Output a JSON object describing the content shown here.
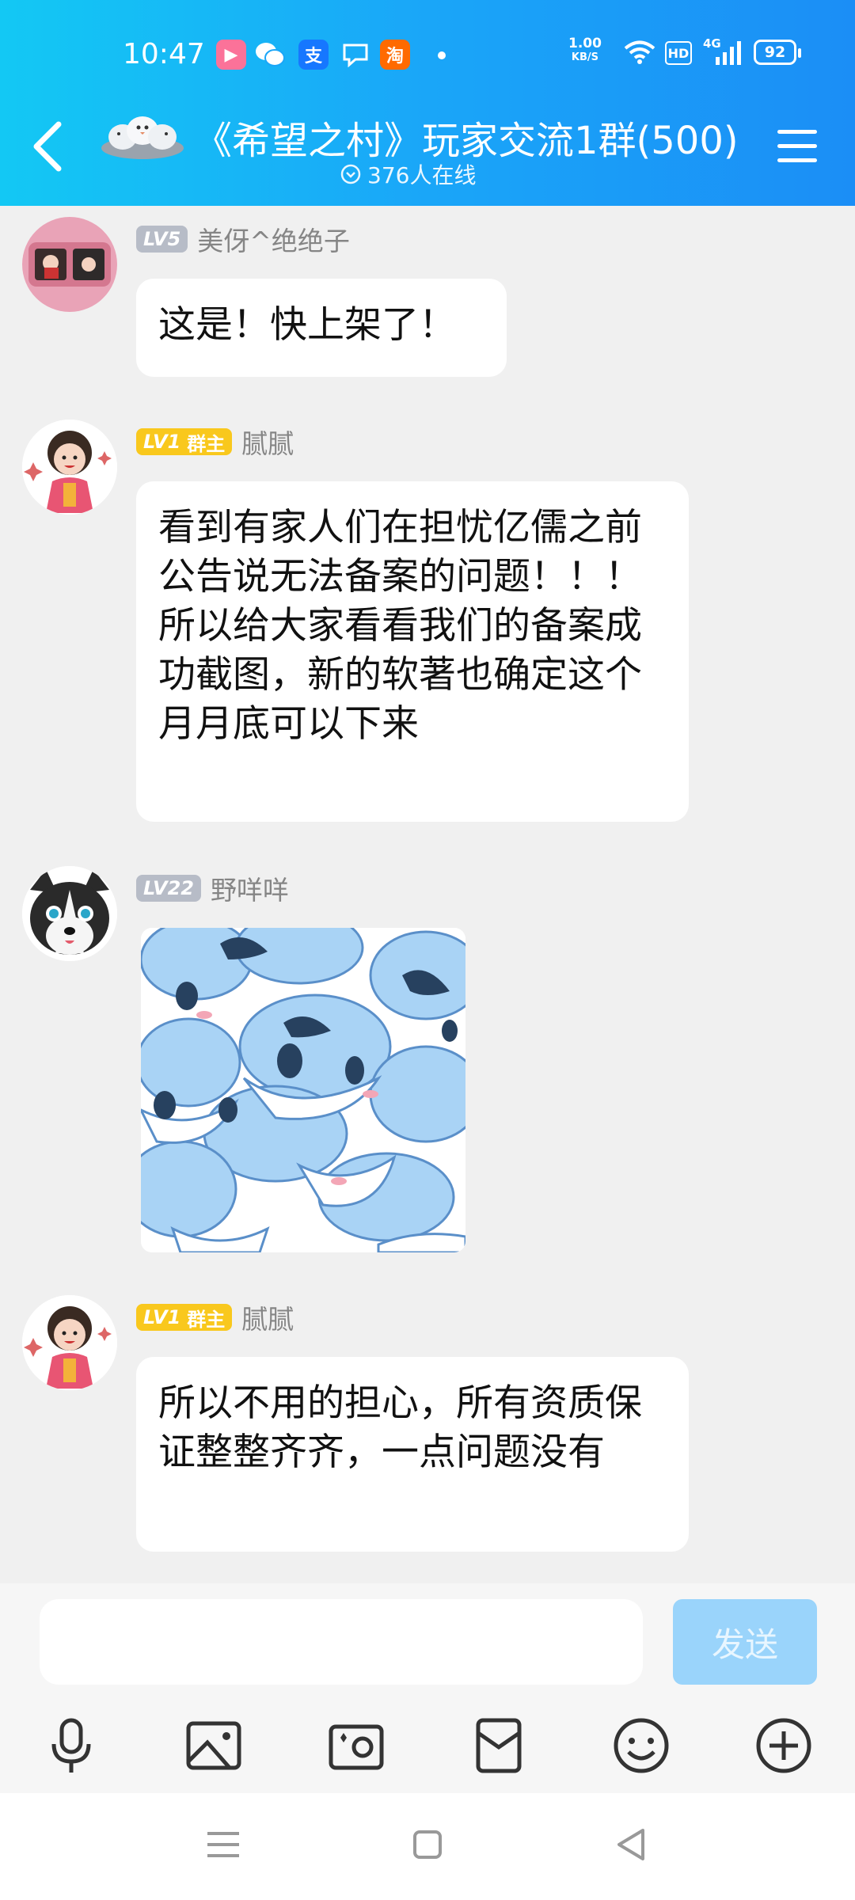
{
  "status_bar": {
    "time": "10:47",
    "net_speed_value": "1.00",
    "net_speed_unit": "KB/S",
    "hd_label": "HD",
    "network_type": "4G",
    "battery": "92"
  },
  "header": {
    "title": "《希望之村》玩家交流1群(500)",
    "online_text": "376人在线"
  },
  "messages": [
    {
      "level": "LV5",
      "role": "",
      "nickname": "美伢^绝绝子",
      "text": "这是！快上架了！"
    },
    {
      "level": "LV1",
      "role": "群主",
      "nickname": "腻腻",
      "text": "看到有家人们在担忧亿儒之前公告说无法备案的问题！！！所以给大家看看我们的备案成功截图，新的软著也确定这个月月底可以下来"
    },
    {
      "level": "LV22",
      "role": "",
      "nickname": "野咩咩",
      "text": ""
    },
    {
      "level": "LV1",
      "role": "群主",
      "nickname": "腻腻",
      "text": "所以不用的担心，所有资质保证整整齐齐，一点问题没有"
    }
  ],
  "input": {
    "value": "",
    "placeholder": "",
    "send_label": "发送"
  },
  "toolbar_icons": [
    "microphone-icon",
    "image-icon",
    "camera-icon",
    "red-packet-icon",
    "emoji-icon",
    "plus-icon"
  ],
  "colors": {
    "header_gradient_start": "#13c8f4",
    "header_gradient_end": "#1b8ef6",
    "send_button": "#9ad4fb",
    "level_gray": "#b7bcc7",
    "level_gold": "#f9c81d",
    "background": "#f0f0f0"
  }
}
